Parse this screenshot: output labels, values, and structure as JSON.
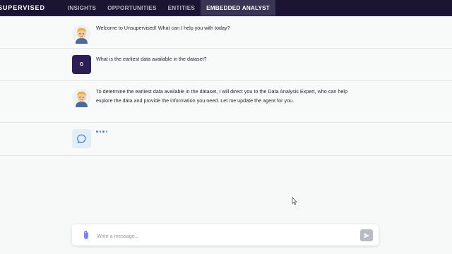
{
  "nav": {
    "brand": "SUPERVISED",
    "items": [
      {
        "label": "INSIGHTS",
        "active": false
      },
      {
        "label": "OPPORTUNITIES",
        "active": false
      },
      {
        "label": "ENTITIES",
        "active": false
      },
      {
        "label": "EMBEDDED ANALYST",
        "active": true
      }
    ]
  },
  "messages": [
    {
      "role": "assistant",
      "avatar_icon": "memoji-avatar-icon",
      "text": "Welcome to Unsupervised! What can I help you with today?"
    },
    {
      "role": "user",
      "avatar_initial": "G",
      "text": "What is the earliest data available in the dataset?"
    },
    {
      "role": "assistant",
      "avatar_icon": "memoji-avatar-icon",
      "text": "To determine the earliest data available in the dataset, I will direct you to the Data Analysis Expert, who can help explore the data and provide the information you need. Let me update the agent for you."
    },
    {
      "role": "agent",
      "avatar_icon": "chat-bubble-icon",
      "status": "typing"
    }
  ],
  "composer": {
    "placeholder": "Write a message...",
    "value": "",
    "attach_icon": "paperclip-icon",
    "send_icon": "send-icon"
  },
  "colors": {
    "nav_bg": "#1b1533",
    "nav_active_bg": "#3a3554",
    "user_avatar_bg": "#2b1f55",
    "typing_dot": "#6d7be0",
    "send_disabled": "#b8bcc2"
  }
}
